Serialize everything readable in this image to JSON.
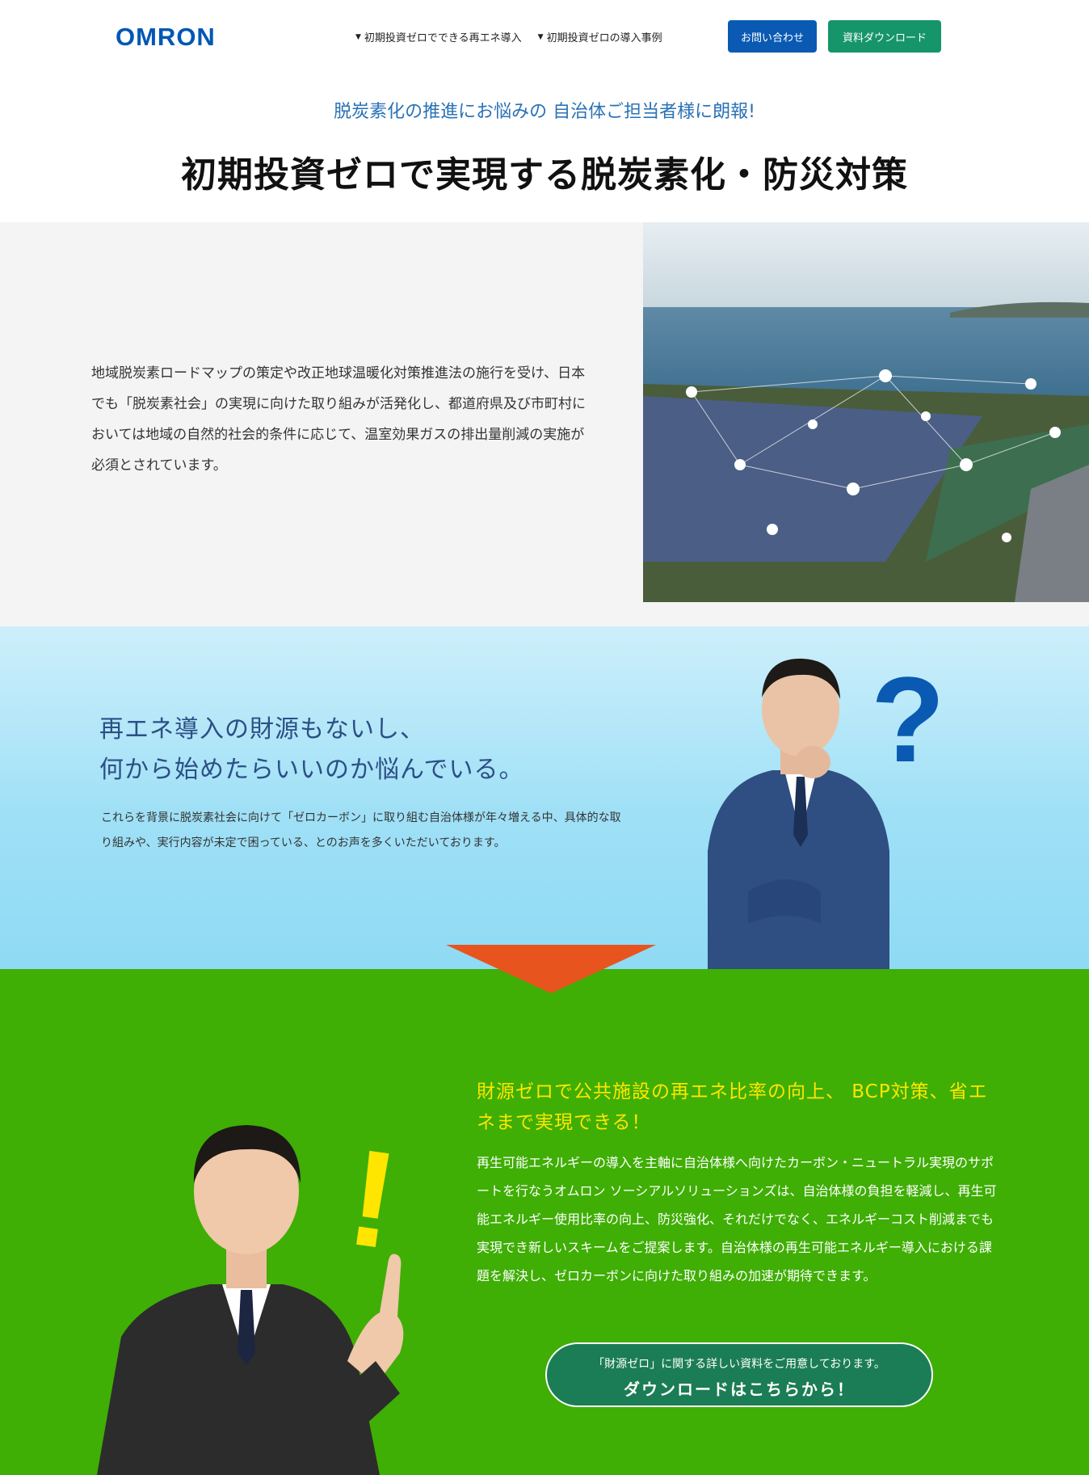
{
  "header": {
    "logo": "OMRON",
    "nav": [
      {
        "label": "初期投資ゼロでできる再エネ導入"
      },
      {
        "label": "初期投資ゼロの導入事例"
      }
    ],
    "contact_label": "お問い合わせ",
    "download_label": "資料ダウンロード"
  },
  "hero": {
    "subtitle": "脱炭素化の推進にお悩みの 自治体ご担当者様に朗報!",
    "title": "初期投資ゼロで実現する脱炭素化・防災対策"
  },
  "intro": {
    "text": "地域脱炭素ロードマップの策定や改正地球温暖化対策推進法の施行を受け、日本でも「脱炭素社会」の実現に向けた取り組みが活発化し、都道府県及び市町村においては地域の自然的社会的条件に応じて、温室効果ガスの排出量削減の実施が必須とされています。"
  },
  "problem": {
    "heading_line1": "再エネ導入の財源もないし、",
    "heading_line2": "何から始めたらいいのか悩んでいる。",
    "text": "これらを背景に脱炭素社会に向けて「ゼロカーボン」に取り組む自治体様が年々増える中、具体的な取り組みや、実行内容が未定で困っている、とのお声を多くいただいております。",
    "mark": "?"
  },
  "solution": {
    "heading": "財源ゼロで公共施設の再エネ比率の向上、 BCP対策、省エネまで実現できる！",
    "text": "再生可能エネルギーの導入を主軸に自治体様へ向けたカーボン・ニュートラル実現のサポートを行なうオムロン ソーシアルソリューションズは、自治体様の負担を軽減し、再生可能エネルギー使用比率の向上、防災強化、それだけでなく、エネルギーコスト削減までも実現でき新しいスキームをご提案します。自治体様の再生可能エネルギー導入における課題を解決し、ゼロカーボンに向けた取り組みの加速が期待できます。",
    "cta_line1": "「財源ゼロ」に関する詳しい資料をご用意しております。",
    "cta_line2": "ダウンロードはこちらから！",
    "mark": "!"
  },
  "colors": {
    "brand_blue": "#0057b4",
    "download_green": "#16956a",
    "solution_green": "#3fae05",
    "arrow_orange": "#e8541e",
    "highlight_yellow": "#ffe600"
  }
}
